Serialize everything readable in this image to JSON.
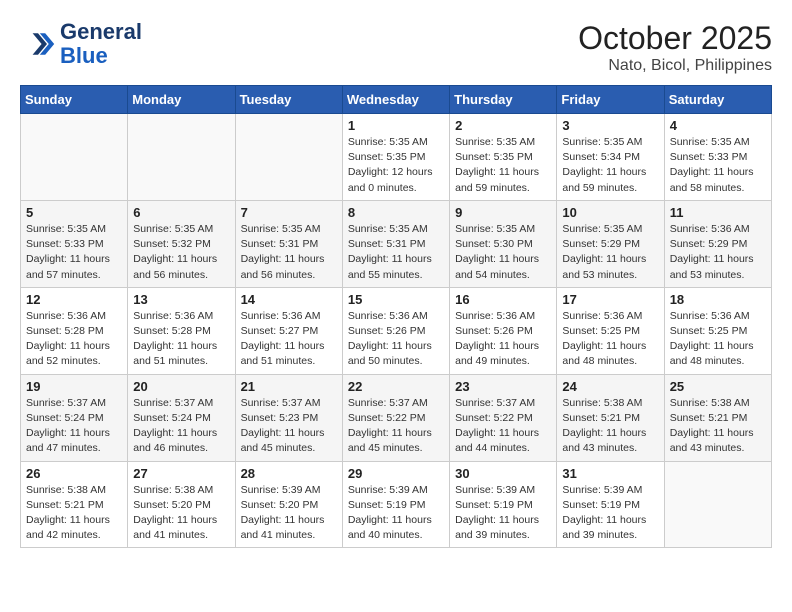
{
  "header": {
    "logo_line1": "General",
    "logo_line2": "Blue",
    "month": "October 2025",
    "location": "Nato, Bicol, Philippines"
  },
  "days_of_week": [
    "Sunday",
    "Monday",
    "Tuesday",
    "Wednesday",
    "Thursday",
    "Friday",
    "Saturday"
  ],
  "weeks": [
    [
      {
        "day": "",
        "sunrise": "",
        "sunset": "",
        "daylight": ""
      },
      {
        "day": "",
        "sunrise": "",
        "sunset": "",
        "daylight": ""
      },
      {
        "day": "",
        "sunrise": "",
        "sunset": "",
        "daylight": ""
      },
      {
        "day": "1",
        "sunrise": "Sunrise: 5:35 AM",
        "sunset": "Sunset: 5:35 PM",
        "daylight": "Daylight: 12 hours and 0 minutes."
      },
      {
        "day": "2",
        "sunrise": "Sunrise: 5:35 AM",
        "sunset": "Sunset: 5:35 PM",
        "daylight": "Daylight: 11 hours and 59 minutes."
      },
      {
        "day": "3",
        "sunrise": "Sunrise: 5:35 AM",
        "sunset": "Sunset: 5:34 PM",
        "daylight": "Daylight: 11 hours and 59 minutes."
      },
      {
        "day": "4",
        "sunrise": "Sunrise: 5:35 AM",
        "sunset": "Sunset: 5:33 PM",
        "daylight": "Daylight: 11 hours and 58 minutes."
      }
    ],
    [
      {
        "day": "5",
        "sunrise": "Sunrise: 5:35 AM",
        "sunset": "Sunset: 5:33 PM",
        "daylight": "Daylight: 11 hours and 57 minutes."
      },
      {
        "day": "6",
        "sunrise": "Sunrise: 5:35 AM",
        "sunset": "Sunset: 5:32 PM",
        "daylight": "Daylight: 11 hours and 56 minutes."
      },
      {
        "day": "7",
        "sunrise": "Sunrise: 5:35 AM",
        "sunset": "Sunset: 5:31 PM",
        "daylight": "Daylight: 11 hours and 56 minutes."
      },
      {
        "day": "8",
        "sunrise": "Sunrise: 5:35 AM",
        "sunset": "Sunset: 5:31 PM",
        "daylight": "Daylight: 11 hours and 55 minutes."
      },
      {
        "day": "9",
        "sunrise": "Sunrise: 5:35 AM",
        "sunset": "Sunset: 5:30 PM",
        "daylight": "Daylight: 11 hours and 54 minutes."
      },
      {
        "day": "10",
        "sunrise": "Sunrise: 5:35 AM",
        "sunset": "Sunset: 5:29 PM",
        "daylight": "Daylight: 11 hours and 53 minutes."
      },
      {
        "day": "11",
        "sunrise": "Sunrise: 5:36 AM",
        "sunset": "Sunset: 5:29 PM",
        "daylight": "Daylight: 11 hours and 53 minutes."
      }
    ],
    [
      {
        "day": "12",
        "sunrise": "Sunrise: 5:36 AM",
        "sunset": "Sunset: 5:28 PM",
        "daylight": "Daylight: 11 hours and 52 minutes."
      },
      {
        "day": "13",
        "sunrise": "Sunrise: 5:36 AM",
        "sunset": "Sunset: 5:28 PM",
        "daylight": "Daylight: 11 hours and 51 minutes."
      },
      {
        "day": "14",
        "sunrise": "Sunrise: 5:36 AM",
        "sunset": "Sunset: 5:27 PM",
        "daylight": "Daylight: 11 hours and 51 minutes."
      },
      {
        "day": "15",
        "sunrise": "Sunrise: 5:36 AM",
        "sunset": "Sunset: 5:26 PM",
        "daylight": "Daylight: 11 hours and 50 minutes."
      },
      {
        "day": "16",
        "sunrise": "Sunrise: 5:36 AM",
        "sunset": "Sunset: 5:26 PM",
        "daylight": "Daylight: 11 hours and 49 minutes."
      },
      {
        "day": "17",
        "sunrise": "Sunrise: 5:36 AM",
        "sunset": "Sunset: 5:25 PM",
        "daylight": "Daylight: 11 hours and 48 minutes."
      },
      {
        "day": "18",
        "sunrise": "Sunrise: 5:36 AM",
        "sunset": "Sunset: 5:25 PM",
        "daylight": "Daylight: 11 hours and 48 minutes."
      }
    ],
    [
      {
        "day": "19",
        "sunrise": "Sunrise: 5:37 AM",
        "sunset": "Sunset: 5:24 PM",
        "daylight": "Daylight: 11 hours and 47 minutes."
      },
      {
        "day": "20",
        "sunrise": "Sunrise: 5:37 AM",
        "sunset": "Sunset: 5:24 PM",
        "daylight": "Daylight: 11 hours and 46 minutes."
      },
      {
        "day": "21",
        "sunrise": "Sunrise: 5:37 AM",
        "sunset": "Sunset: 5:23 PM",
        "daylight": "Daylight: 11 hours and 45 minutes."
      },
      {
        "day": "22",
        "sunrise": "Sunrise: 5:37 AM",
        "sunset": "Sunset: 5:22 PM",
        "daylight": "Daylight: 11 hours and 45 minutes."
      },
      {
        "day": "23",
        "sunrise": "Sunrise: 5:37 AM",
        "sunset": "Sunset: 5:22 PM",
        "daylight": "Daylight: 11 hours and 44 minutes."
      },
      {
        "day": "24",
        "sunrise": "Sunrise: 5:38 AM",
        "sunset": "Sunset: 5:21 PM",
        "daylight": "Daylight: 11 hours and 43 minutes."
      },
      {
        "day": "25",
        "sunrise": "Sunrise: 5:38 AM",
        "sunset": "Sunset: 5:21 PM",
        "daylight": "Daylight: 11 hours and 43 minutes."
      }
    ],
    [
      {
        "day": "26",
        "sunrise": "Sunrise: 5:38 AM",
        "sunset": "Sunset: 5:21 PM",
        "daylight": "Daylight: 11 hours and 42 minutes."
      },
      {
        "day": "27",
        "sunrise": "Sunrise: 5:38 AM",
        "sunset": "Sunset: 5:20 PM",
        "daylight": "Daylight: 11 hours and 41 minutes."
      },
      {
        "day": "28",
        "sunrise": "Sunrise: 5:39 AM",
        "sunset": "Sunset: 5:20 PM",
        "daylight": "Daylight: 11 hours and 41 minutes."
      },
      {
        "day": "29",
        "sunrise": "Sunrise: 5:39 AM",
        "sunset": "Sunset: 5:19 PM",
        "daylight": "Daylight: 11 hours and 40 minutes."
      },
      {
        "day": "30",
        "sunrise": "Sunrise: 5:39 AM",
        "sunset": "Sunset: 5:19 PM",
        "daylight": "Daylight: 11 hours and 39 minutes."
      },
      {
        "day": "31",
        "sunrise": "Sunrise: 5:39 AM",
        "sunset": "Sunset: 5:19 PM",
        "daylight": "Daylight: 11 hours and 39 minutes."
      },
      {
        "day": "",
        "sunrise": "",
        "sunset": "",
        "daylight": ""
      }
    ]
  ]
}
